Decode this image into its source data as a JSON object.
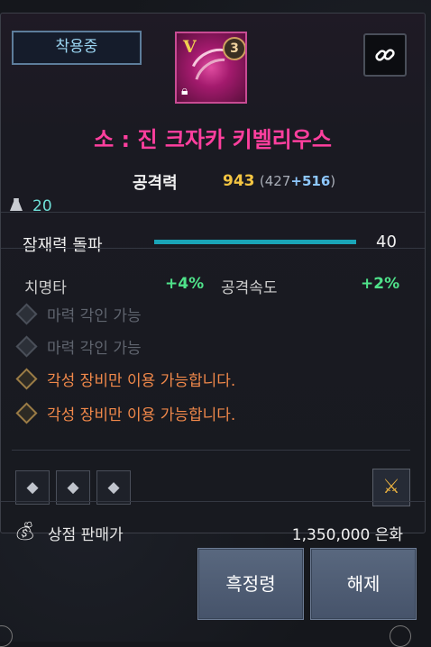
{
  "status_badge": "착용중",
  "item": {
    "grade_mark": "V",
    "level": "3",
    "icon": "feather-weapon-icon",
    "name": "소 : 진 크자카 키벨리우스",
    "name_color": "#ff3f9e"
  },
  "stat": {
    "label": "공격력",
    "total": "943",
    "base_open": "(427",
    "bonus": "+516",
    "close": ")"
  },
  "weight": "20",
  "breakthrough": {
    "label": "잠재력 돌파",
    "value": "40",
    "fill": 1.0
  },
  "substats": [
    {
      "label": "치명타",
      "value": "+4%"
    },
    {
      "label": "공격속도",
      "value": "+2%"
    }
  ],
  "engravings": [
    {
      "text": "마력 각인 가능",
      "state": "inactive"
    },
    {
      "text": "마력 각인 가능",
      "state": "inactive"
    },
    {
      "text": "각성 장비만 이용 가능합니다.",
      "state": "active"
    },
    {
      "text": "각성 장비만 이용 가능합니다.",
      "state": "active"
    }
  ],
  "gem_slots": [
    "gem-slot-icon",
    "gem-slot-icon",
    "gem-slot-icon"
  ],
  "class_icon": "crossed-swords-icon",
  "shop": {
    "label": "상점 판매가",
    "value": "1,350,000 은화"
  },
  "buttons": {
    "refine": "흑정령",
    "unequip": "해제"
  },
  "colors": {
    "accent_cyan": "#1aa5b8",
    "positive_green": "#4fe28a",
    "engrave_orange": "#f0884a",
    "stat_gold": "#f4c542"
  }
}
